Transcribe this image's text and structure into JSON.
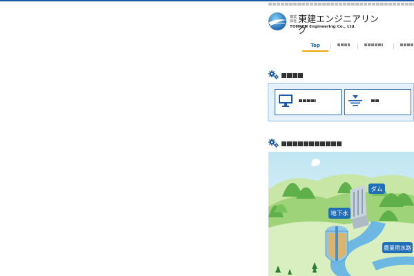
{
  "header": {
    "tagline": "",
    "logo": {
      "name_ja": "東建エンジニアリング",
      "kabushiki": "株式会社",
      "name_en": "TOHKEN Engineering Co., Ltd."
    }
  },
  "nav": {
    "items": [
      {
        "label": "Top",
        "active": true
      },
      {
        "label": ""
      },
      {
        "label": ""
      },
      {
        "label": ""
      }
    ]
  },
  "section1": {
    "title": "",
    "cards": [
      {
        "label": "",
        "icon": "monitor-icon"
      },
      {
        "label": "",
        "icon": "water-level-icon"
      }
    ]
  },
  "section2": {
    "title": "",
    "map_labels": {
      "dam": "ダム",
      "groundwater": "地下水",
      "farm_channel": "農業用水路"
    }
  },
  "colors": {
    "brand_blue": "#1a5aa8",
    "accent_orange": "#f0a500",
    "panel_bg": "#e6f0fa"
  }
}
